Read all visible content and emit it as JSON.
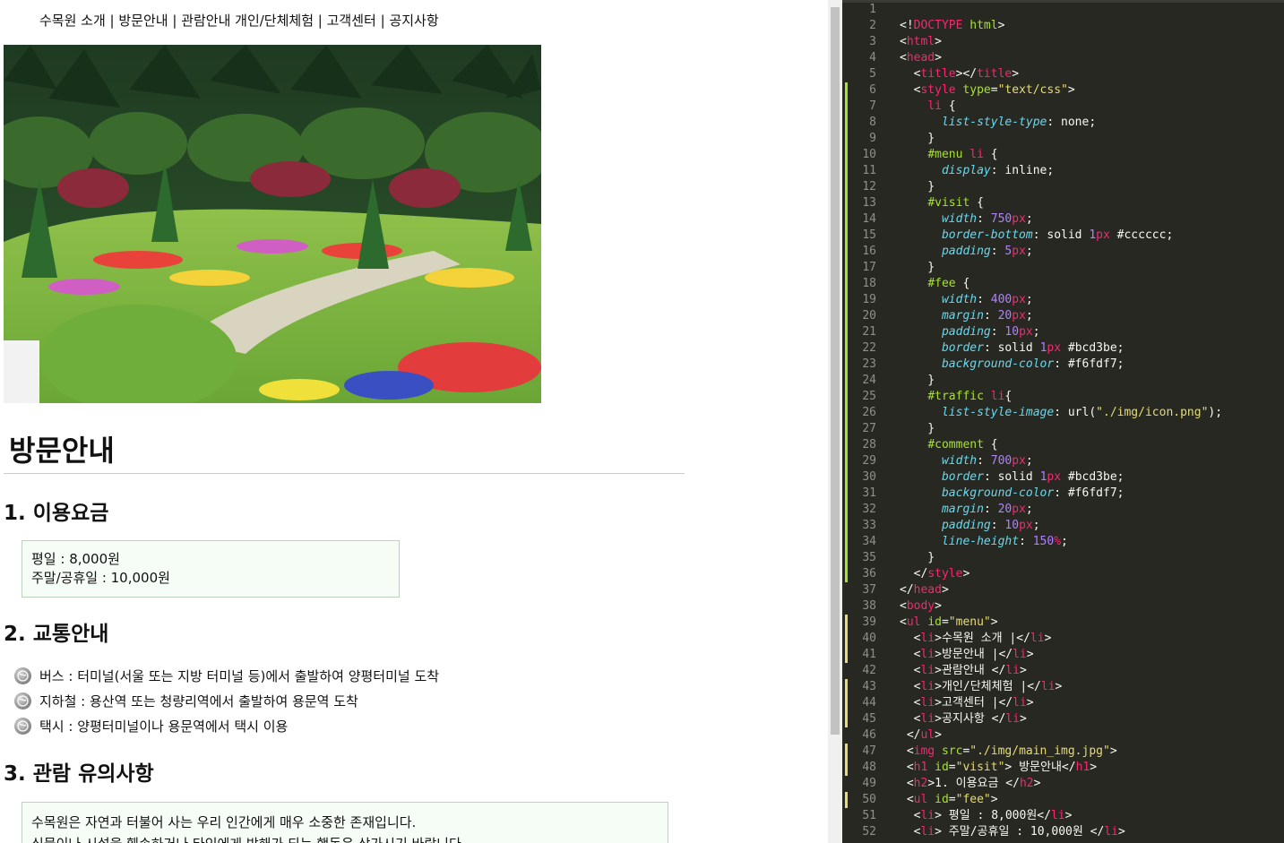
{
  "browser": {
    "menu": [
      "수목원 소개 |",
      "방문안내 |",
      "관람안내 개인/단체체험 |",
      "고객센터 |",
      "공지사항"
    ],
    "visit_title": "방문안내",
    "fee_heading": "1. 이용요금",
    "fee_items": [
      "평일 : 8,000원",
      "주말/공휴일 : 10,000원"
    ],
    "traffic_heading": "2. 교통안내",
    "traffic_items": [
      "버스 : 터미널(서울 또는 지방 터미널 등)에서 출발하여 양평터미널 도착",
      "지하철 : 용산역 또는 청량리역에서 출발하여 용문역 도착",
      "택시 : 양평터미널이나 용문역에서 택시 이용"
    ],
    "comment_heading": "3. 관람 유의사항",
    "comment_lines": [
      "수목원은 자연과 터불어 사는 우리 인간에게 매우 소중한 존재입니다.",
      "식물이나 시설을 훼손하거나 타인에게 방해가 되는 행동은 삼가시기 바랍니다."
    ]
  },
  "editor": {
    "lines": [
      {
        "n": "1",
        "m": "",
        "segs": []
      },
      {
        "n": "2",
        "m": "",
        "segs": [
          [
            "w",
            "<!"
          ],
          [
            "t",
            "DOCTYPE"
          ],
          [
            "w",
            " "
          ],
          [
            "a",
            "html"
          ],
          [
            "w",
            ">"
          ]
        ]
      },
      {
        "n": "3",
        "m": "",
        "segs": [
          [
            "w",
            "<"
          ],
          [
            "t",
            "html"
          ],
          [
            "w",
            ">"
          ]
        ]
      },
      {
        "n": "4",
        "m": "",
        "segs": [
          [
            "w",
            "<"
          ],
          [
            "t",
            "head"
          ],
          [
            "w",
            ">"
          ]
        ]
      },
      {
        "n": "5",
        "m": "",
        "segs": [
          [
            "w",
            "  <"
          ],
          [
            "t",
            "title"
          ],
          [
            "w",
            "></"
          ],
          [
            "t",
            "title"
          ],
          [
            "w",
            ">"
          ]
        ]
      },
      {
        "n": "6",
        "m": "mod",
        "segs": [
          [
            "w",
            "  <"
          ],
          [
            "t",
            "style"
          ],
          [
            "w",
            " "
          ],
          [
            "a",
            "type"
          ],
          [
            "w",
            "="
          ],
          [
            "s",
            "\"text/css\""
          ],
          [
            "w",
            ">"
          ]
        ]
      },
      {
        "n": "7",
        "m": "mod",
        "segs": [
          [
            "w",
            "    "
          ],
          [
            "t",
            "li"
          ],
          [
            "w",
            " {"
          ]
        ]
      },
      {
        "n": "8",
        "m": "mod",
        "segs": [
          [
            "w",
            "      "
          ],
          [
            "p",
            "list-style-type"
          ],
          [
            "w",
            ": none;"
          ]
        ]
      },
      {
        "n": "9",
        "m": "mod",
        "segs": [
          [
            "w",
            "    }"
          ]
        ]
      },
      {
        "n": "10",
        "m": "mod",
        "segs": [
          [
            "w",
            "    "
          ],
          [
            "a",
            "#menu"
          ],
          [
            "w",
            " "
          ],
          [
            "t",
            "li"
          ],
          [
            "w",
            " {"
          ]
        ]
      },
      {
        "n": "11",
        "m": "mod",
        "segs": [
          [
            "w",
            "      "
          ],
          [
            "p",
            "display"
          ],
          [
            "w",
            ": inline;"
          ]
        ]
      },
      {
        "n": "12",
        "m": "mod",
        "segs": [
          [
            "w",
            "    }"
          ]
        ]
      },
      {
        "n": "13",
        "m": "mod",
        "segs": [
          [
            "w",
            "    "
          ],
          [
            "a",
            "#visit"
          ],
          [
            "w",
            " {"
          ]
        ]
      },
      {
        "n": "14",
        "m": "mod",
        "segs": [
          [
            "w",
            "      "
          ],
          [
            "p",
            "width"
          ],
          [
            "w",
            ": "
          ],
          [
            "n",
            "750"
          ],
          [
            "k",
            "px"
          ],
          [
            "w",
            ";"
          ]
        ]
      },
      {
        "n": "15",
        "m": "mod",
        "segs": [
          [
            "w",
            "      "
          ],
          [
            "p",
            "border-bottom"
          ],
          [
            "w",
            ": solid "
          ],
          [
            "n",
            "1"
          ],
          [
            "k",
            "px"
          ],
          [
            "w",
            " #cccccc;"
          ]
        ]
      },
      {
        "n": "16",
        "m": "mod",
        "segs": [
          [
            "w",
            "      "
          ],
          [
            "p",
            "padding"
          ],
          [
            "w",
            ": "
          ],
          [
            "n",
            "5"
          ],
          [
            "k",
            "px"
          ],
          [
            "w",
            ";"
          ]
        ]
      },
      {
        "n": "17",
        "m": "mod",
        "segs": [
          [
            "w",
            "    }"
          ]
        ]
      },
      {
        "n": "18",
        "m": "mod",
        "segs": [
          [
            "w",
            "    "
          ],
          [
            "a",
            "#fee"
          ],
          [
            "w",
            " {"
          ]
        ]
      },
      {
        "n": "19",
        "m": "mod",
        "segs": [
          [
            "w",
            "      "
          ],
          [
            "p",
            "width"
          ],
          [
            "w",
            ": "
          ],
          [
            "n",
            "400"
          ],
          [
            "k",
            "px"
          ],
          [
            "w",
            ";"
          ]
        ]
      },
      {
        "n": "20",
        "m": "mod",
        "segs": [
          [
            "w",
            "      "
          ],
          [
            "p",
            "margin"
          ],
          [
            "w",
            ": "
          ],
          [
            "n",
            "20"
          ],
          [
            "k",
            "px"
          ],
          [
            "w",
            ";"
          ]
        ]
      },
      {
        "n": "21",
        "m": "mod",
        "segs": [
          [
            "w",
            "      "
          ],
          [
            "p",
            "padding"
          ],
          [
            "w",
            ": "
          ],
          [
            "n",
            "10"
          ],
          [
            "k",
            "px"
          ],
          [
            "w",
            ";"
          ]
        ]
      },
      {
        "n": "22",
        "m": "mod",
        "segs": [
          [
            "w",
            "      "
          ],
          [
            "p",
            "border"
          ],
          [
            "w",
            ": solid "
          ],
          [
            "n",
            "1"
          ],
          [
            "k",
            "px"
          ],
          [
            "w",
            " #bcd3be;"
          ]
        ]
      },
      {
        "n": "23",
        "m": "mod",
        "segs": [
          [
            "w",
            "      "
          ],
          [
            "p",
            "background-color"
          ],
          [
            "w",
            ": #f6fdf7;"
          ]
        ]
      },
      {
        "n": "24",
        "m": "mod",
        "segs": [
          [
            "w",
            "    }"
          ]
        ]
      },
      {
        "n": "25",
        "m": "mod",
        "segs": [
          [
            "w",
            "    "
          ],
          [
            "a",
            "#traffic"
          ],
          [
            "w",
            " "
          ],
          [
            "t",
            "li"
          ],
          [
            "w",
            "{"
          ]
        ]
      },
      {
        "n": "26",
        "m": "mod",
        "segs": [
          [
            "w",
            "      "
          ],
          [
            "p",
            "list-style-image"
          ],
          [
            "w",
            ": url("
          ],
          [
            "s",
            "\"./img/icon.png\""
          ],
          [
            "w",
            ");"
          ]
        ]
      },
      {
        "n": "27",
        "m": "mod",
        "segs": [
          [
            "w",
            "    }"
          ]
        ]
      },
      {
        "n": "28",
        "m": "mod",
        "segs": [
          [
            "w",
            "    "
          ],
          [
            "a",
            "#comment"
          ],
          [
            "w",
            " {"
          ]
        ]
      },
      {
        "n": "29",
        "m": "mod",
        "segs": [
          [
            "w",
            "      "
          ],
          [
            "p",
            "width"
          ],
          [
            "w",
            ": "
          ],
          [
            "n",
            "700"
          ],
          [
            "k",
            "px"
          ],
          [
            "w",
            ";"
          ]
        ]
      },
      {
        "n": "30",
        "m": "mod",
        "segs": [
          [
            "w",
            "      "
          ],
          [
            "p",
            "border"
          ],
          [
            "w",
            ": solid "
          ],
          [
            "n",
            "1"
          ],
          [
            "k",
            "px"
          ],
          [
            "w",
            " #bcd3be;"
          ]
        ]
      },
      {
        "n": "31",
        "m": "mod",
        "segs": [
          [
            "w",
            "      "
          ],
          [
            "p",
            "background-color"
          ],
          [
            "w",
            ": #f6fdf7;"
          ]
        ]
      },
      {
        "n": "32",
        "m": "mod",
        "segs": [
          [
            "w",
            "      "
          ],
          [
            "p",
            "margin"
          ],
          [
            "w",
            ": "
          ],
          [
            "n",
            "20"
          ],
          [
            "k",
            "px"
          ],
          [
            "w",
            ";"
          ]
        ]
      },
      {
        "n": "33",
        "m": "mod",
        "segs": [
          [
            "w",
            "      "
          ],
          [
            "p",
            "padding"
          ],
          [
            "w",
            ": "
          ],
          [
            "n",
            "10"
          ],
          [
            "k",
            "px"
          ],
          [
            "w",
            ";"
          ]
        ]
      },
      {
        "n": "34",
        "m": "mod",
        "segs": [
          [
            "w",
            "      "
          ],
          [
            "p",
            "line-height"
          ],
          [
            "w",
            ": "
          ],
          [
            "n",
            "150"
          ],
          [
            "k",
            "%"
          ],
          [
            "w",
            ";"
          ]
        ]
      },
      {
        "n": "35",
        "m": "mod",
        "segs": [
          [
            "w",
            "    }"
          ]
        ]
      },
      {
        "n": "36",
        "m": "mod",
        "segs": [
          [
            "w",
            "  </"
          ],
          [
            "t",
            "style"
          ],
          [
            "w",
            ">"
          ]
        ]
      },
      {
        "n": "37",
        "m": "",
        "segs": [
          [
            "w",
            "</"
          ],
          [
            "t",
            "head"
          ],
          [
            "w",
            ">"
          ]
        ]
      },
      {
        "n": "38",
        "m": "",
        "segs": [
          [
            "w",
            "<"
          ],
          [
            "t",
            "body"
          ],
          [
            "w",
            ">"
          ]
        ]
      },
      {
        "n": "39",
        "m": "add",
        "segs": [
          [
            "w",
            "<"
          ],
          [
            "t",
            "ul"
          ],
          [
            "w",
            " "
          ],
          [
            "a",
            "id"
          ],
          [
            "w",
            "="
          ],
          [
            "s",
            "\"menu\""
          ],
          [
            "w",
            ">"
          ]
        ]
      },
      {
        "n": "40",
        "m": "add",
        "segs": [
          [
            "w",
            "  <"
          ],
          [
            "t",
            "li"
          ],
          [
            "w",
            ">수목원 소개 |</"
          ],
          [
            "t",
            "li"
          ],
          [
            "w",
            ">"
          ]
        ]
      },
      {
        "n": "41",
        "m": "add",
        "segs": [
          [
            "w",
            "  <"
          ],
          [
            "t",
            "li"
          ],
          [
            "w",
            ">방문안내 |</"
          ],
          [
            "t",
            "li"
          ],
          [
            "w",
            ">"
          ]
        ]
      },
      {
        "n": "42",
        "m": "",
        "segs": [
          [
            "w",
            "  <"
          ],
          [
            "t",
            "li"
          ],
          [
            "w",
            ">관람안내 </"
          ],
          [
            "t",
            "li"
          ],
          [
            "w",
            ">"
          ]
        ]
      },
      {
        "n": "43",
        "m": "add",
        "segs": [
          [
            "w",
            "  <"
          ],
          [
            "t",
            "li"
          ],
          [
            "w",
            ">개인/단체체험 |</"
          ],
          [
            "t",
            "li"
          ],
          [
            "w",
            ">"
          ]
        ]
      },
      {
        "n": "44",
        "m": "add",
        "segs": [
          [
            "w",
            "  <"
          ],
          [
            "t",
            "li"
          ],
          [
            "w",
            ">고객센터 |</"
          ],
          [
            "t",
            "li"
          ],
          [
            "w",
            ">"
          ]
        ]
      },
      {
        "n": "45",
        "m": "add",
        "segs": [
          [
            "w",
            "  <"
          ],
          [
            "t",
            "li"
          ],
          [
            "w",
            ">공지사항 </"
          ],
          [
            "t",
            "li"
          ],
          [
            "w",
            ">"
          ]
        ]
      },
      {
        "n": "46",
        "m": "",
        "segs": [
          [
            "w",
            " </"
          ],
          [
            "t",
            "ul"
          ],
          [
            "w",
            ">"
          ]
        ]
      },
      {
        "n": "47",
        "m": "add",
        "segs": [
          [
            "w",
            " <"
          ],
          [
            "t",
            "img"
          ],
          [
            "w",
            " "
          ],
          [
            "a",
            "src"
          ],
          [
            "w",
            "="
          ],
          [
            "s",
            "\"./img/main_img.jpg\""
          ],
          [
            "w",
            ">"
          ]
        ]
      },
      {
        "n": "48",
        "m": "add",
        "segs": [
          [
            "w",
            " <"
          ],
          [
            "t",
            "h1"
          ],
          [
            "w",
            " "
          ],
          [
            "a",
            "id"
          ],
          [
            "w",
            "="
          ],
          [
            "s",
            "\"visit\""
          ],
          [
            "w",
            "> 방문안내</"
          ],
          [
            "t",
            "h1"
          ],
          [
            "w",
            ">"
          ]
        ]
      },
      {
        "n": "49",
        "m": "",
        "segs": [
          [
            "w",
            " <"
          ],
          [
            "t",
            "h2"
          ],
          [
            "w",
            ">1. 이용요금 </"
          ],
          [
            "t",
            "h2"
          ],
          [
            "w",
            ">"
          ]
        ]
      },
      {
        "n": "50",
        "m": "add",
        "segs": [
          [
            "w",
            " <"
          ],
          [
            "t",
            "ul"
          ],
          [
            "w",
            " "
          ],
          [
            "a",
            "id"
          ],
          [
            "w",
            "="
          ],
          [
            "s",
            "\"fee\""
          ],
          [
            "w",
            ">"
          ]
        ]
      },
      {
        "n": "51",
        "m": "",
        "segs": [
          [
            "w",
            "  <"
          ],
          [
            "t",
            "li"
          ],
          [
            "w",
            "> 평일 : 8,000원</"
          ],
          [
            "t",
            "li"
          ],
          [
            "w",
            ">"
          ]
        ]
      },
      {
        "n": "52",
        "m": "",
        "segs": [
          [
            "w",
            "  <"
          ],
          [
            "t",
            "li"
          ],
          [
            "w",
            "> 주말/공휴일 : 10,000원 </"
          ],
          [
            "t",
            "li"
          ],
          [
            "w",
            ">"
          ]
        ]
      }
    ]
  }
}
